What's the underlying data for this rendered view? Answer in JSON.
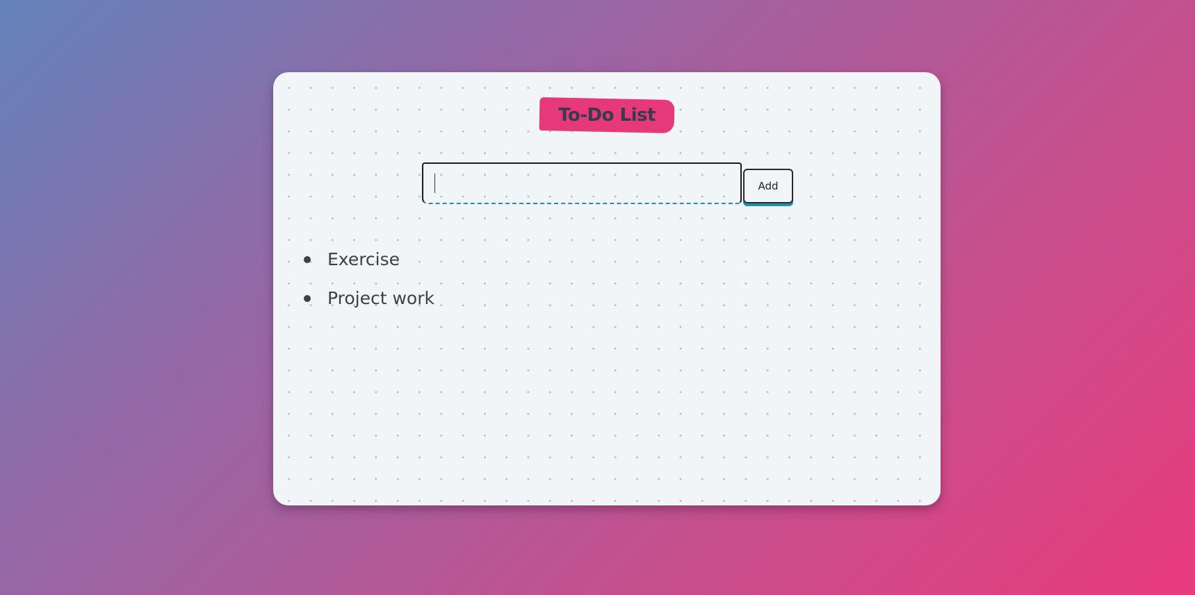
{
  "app": {
    "title": "To-Do List"
  },
  "entry": {
    "input_value": "",
    "input_placeholder": "",
    "add_label": "Add"
  },
  "todos": [
    {
      "text": "Exercise"
    },
    {
      "text": "Project work"
    }
  ],
  "colors": {
    "accent": "#e5397a",
    "underline": "#1f8fb0",
    "text": "#3e4046",
    "card_bg": "#f1f5f7"
  }
}
